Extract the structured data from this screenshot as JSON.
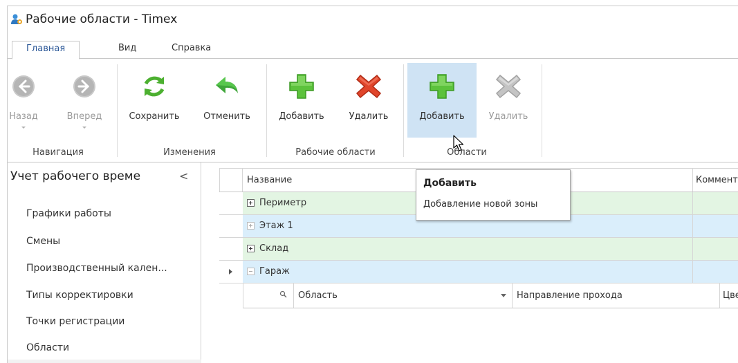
{
  "window": {
    "title": "Рабочие области - Timex"
  },
  "tabs": [
    {
      "label": "Главная",
      "active": true
    },
    {
      "label": "Вид",
      "active": false
    },
    {
      "label": "Справка",
      "active": false
    }
  ],
  "ribbon": {
    "groups": [
      {
        "label": "Навигация"
      },
      {
        "label": "Изменения"
      },
      {
        "label": "Рабочие области"
      },
      {
        "label": "Области"
      }
    ],
    "buttons": {
      "back": {
        "label": "Назад",
        "icon": "arrow-left-icon",
        "enabled": false
      },
      "forward": {
        "label": "Вперед",
        "icon": "arrow-right-icon",
        "enabled": false
      },
      "save": {
        "label": "Сохранить",
        "icon": "refresh-icon",
        "enabled": true
      },
      "undo": {
        "label": "Отменить",
        "icon": "undo-icon",
        "enabled": true
      },
      "add_workspace": {
        "label": "Добавить",
        "icon": "plus-icon",
        "enabled": true
      },
      "delete_workspace": {
        "label": "Удалить",
        "icon": "close-x-icon",
        "enabled": true
      },
      "add_area": {
        "label": "Добавить",
        "icon": "plus-icon",
        "enabled": true,
        "hovered": true
      },
      "delete_area": {
        "label": "Удалить",
        "icon": "close-x-icon",
        "enabled": false
      }
    }
  },
  "sidebar": {
    "title": "Учет рабочего време",
    "collapse_glyph": "<",
    "items": [
      {
        "label": "Графики работы"
      },
      {
        "label": "Смены"
      },
      {
        "label": "Производственный кален..."
      },
      {
        "label": "Типы корректировки"
      },
      {
        "label": "Точки регистрации"
      },
      {
        "label": "Области"
      }
    ]
  },
  "grid": {
    "columns": {
      "name": "Название",
      "comment": "Коммент"
    },
    "rows": [
      {
        "name": "Периметр",
        "expanded": false,
        "color": "green"
      },
      {
        "name": "Этаж 1",
        "expanded": false,
        "color": "blue"
      },
      {
        "name": "Склад",
        "expanded": false,
        "color": "green"
      },
      {
        "name": "Гараж",
        "expanded": true,
        "color": "blue",
        "current": true
      }
    ],
    "detail_columns": {
      "area": "Область",
      "direction": "Направление прохода",
      "color": "Цве"
    }
  },
  "tooltip": {
    "title": "Добавить",
    "text": "Добавление новой зоны"
  },
  "colors": {
    "accent": "#2b5797",
    "hover": "#cfe3f4",
    "row_green": "#e3f5e3",
    "row_blue": "#daeefb",
    "plus_green": "#5cc23c",
    "delete_red": "#e0452b"
  }
}
